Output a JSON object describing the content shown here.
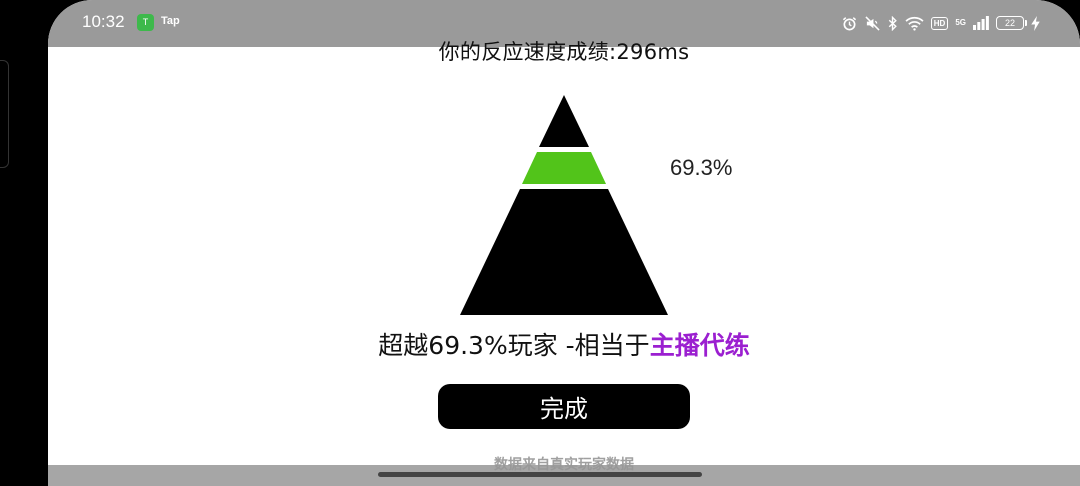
{
  "status_bar": {
    "time": "10:32",
    "app_icon_text": "T",
    "app_label": "Tap",
    "hd": "HD",
    "network": "5G",
    "battery": "22"
  },
  "result": {
    "title": "你的反应速度成绩:296ms",
    "percent": "69.3%",
    "percent_fraction": 0.693,
    "beat_text": "超越69.3%玩家  -相当于",
    "rank": "主播代练",
    "done_label": "完成",
    "footnote": "数据来自真实玩家数据"
  },
  "colors": {
    "highlight_tier": "#52c41a",
    "rank_text": "#9b1fd0",
    "pyramid": "#000000"
  },
  "icons": [
    "alarm-icon",
    "mute-icon",
    "bluetooth-icon",
    "wifi-icon",
    "signal-icon",
    "charging-icon"
  ]
}
